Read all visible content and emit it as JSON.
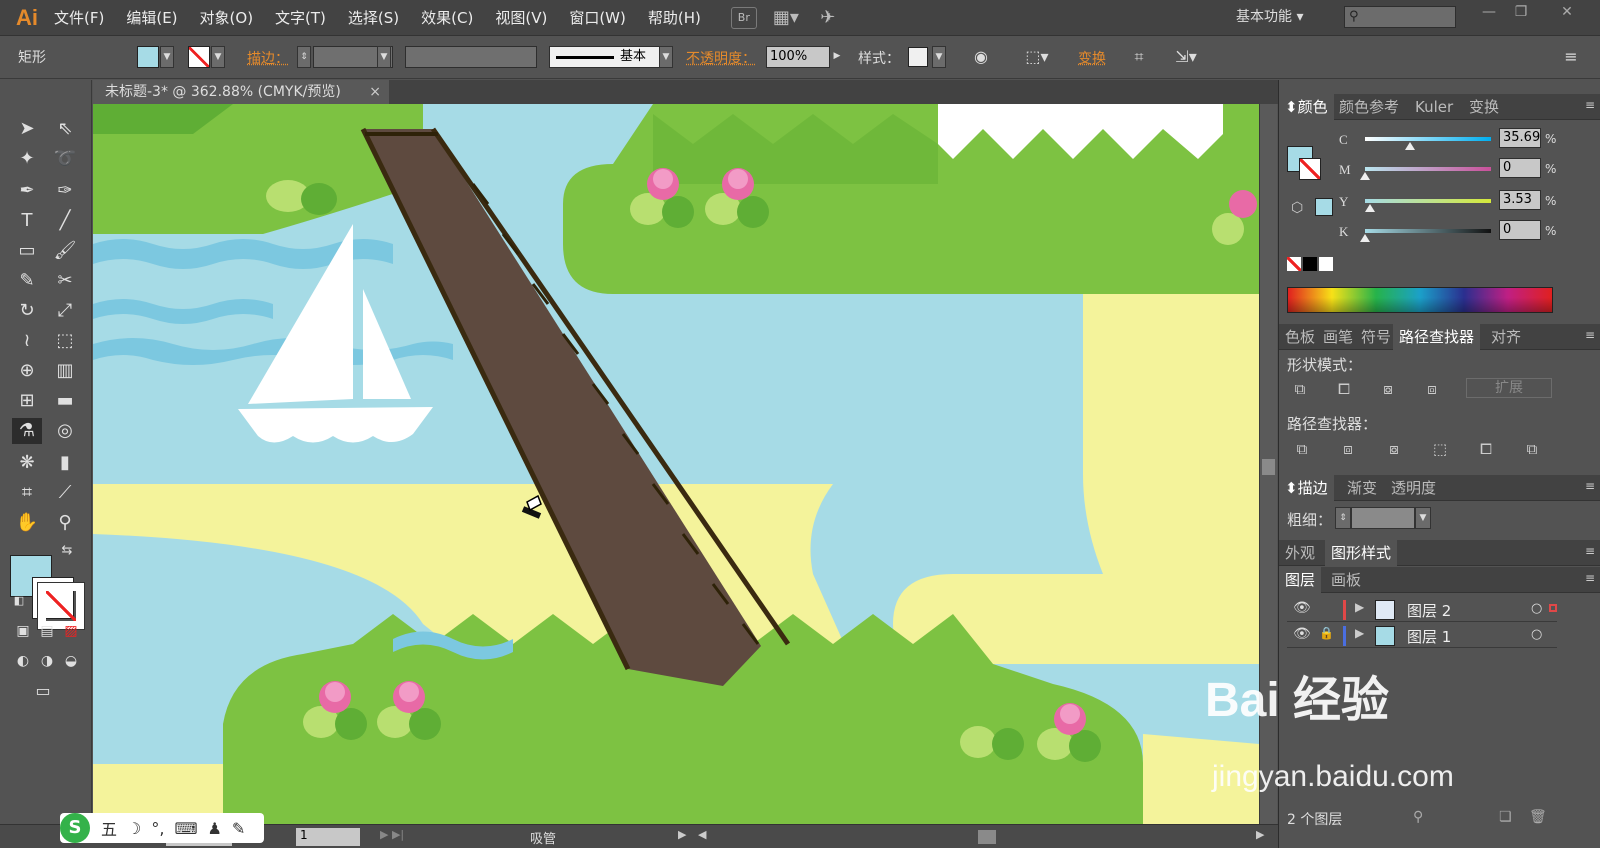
{
  "app": {
    "logo": "Ai",
    "menu": [
      "文件(F)",
      "编辑(E)",
      "对象(O)",
      "文字(T)",
      "选择(S)",
      "效果(C)",
      "视图(V)",
      "窗口(W)",
      "帮助(H)"
    ],
    "bridge_label": "Br",
    "workspace": "基本功能",
    "search_placeholder": ""
  },
  "control_bar": {
    "object_type": "矩形",
    "stroke_link": "描边：",
    "stroke_profile_label": "基本",
    "opacity_link": "不透明度：",
    "opacity_value": "100%",
    "style_label": "样式：",
    "transform_link": "变换",
    "fill_color": "#a6dbe6"
  },
  "document": {
    "tab_title": "未标题-3* @ 362.88% (CMYK/预览)",
    "close_glyph": "×"
  },
  "status_bar": {
    "zoom": "362.88",
    "artboard_number": "1",
    "current_tool": "吸管"
  },
  "ime": {
    "logo": "S",
    "mode": "五",
    "glyphs": [
      "☽",
      "°,",
      "⌨",
      "♟",
      "✎"
    ]
  },
  "color_panel": {
    "tabs": [
      "颜色",
      "颜色参考",
      "Kuler",
      "变换"
    ],
    "channels": [
      {
        "label": "C",
        "value": "35.69",
        "level": 0.357
      },
      {
        "label": "M",
        "value": "0",
        "level": 0
      },
      {
        "label": "Y",
        "value": "3.53",
        "level": 0.035
      },
      {
        "label": "K",
        "value": "0",
        "level": 0
      }
    ],
    "pct": "%",
    "fill_color": "#a6dbe6"
  },
  "pathfinder_panel": {
    "tabs": [
      "色板",
      "画笔",
      "符号",
      "路径查找器",
      "对齐"
    ],
    "shape_modes_title": "形状模式：",
    "expand_label": "扩展",
    "pathfinders_title": "路径查找器："
  },
  "stroke_panel": {
    "tabs": [
      "描边",
      "渐变",
      "透明度"
    ],
    "weight_label": "粗细："
  },
  "appearance_panel": {
    "tabs": [
      "外观",
      "图形样式"
    ]
  },
  "layers_panel": {
    "tabs": [
      "图层",
      "画板"
    ],
    "layers": [
      {
        "name": "图层 2",
        "color": "#e04848",
        "locked": false
      },
      {
        "name": "图层 1",
        "color": "#4a6ee0",
        "locked": true
      }
    ],
    "count": "2 个图层"
  },
  "watermark": {
    "brand": "Bai 经验",
    "url": "jingyan.baidu.com"
  }
}
